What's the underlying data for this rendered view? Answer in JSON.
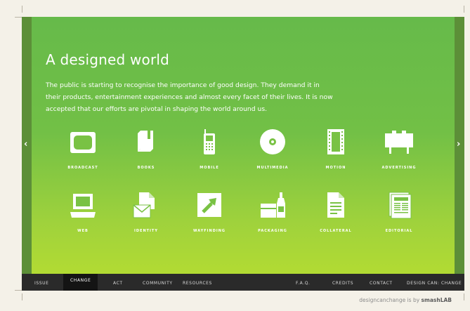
{
  "hero": {
    "title": "A designed world",
    "text": "The public is starting to recognise the importance of good design. They demand it in their products, entertainment experiences and almost every facet of their lives. It is now accepted that our efforts are pivotal in shaping the world around us."
  },
  "categories": [
    {
      "label": "BROADCAST",
      "icon": "tv-icon"
    },
    {
      "label": "BOOKS",
      "icon": "book-icon"
    },
    {
      "label": "MOBILE",
      "icon": "mobile-phone-icon"
    },
    {
      "label": "MULTIMEDIA",
      "icon": "disc-icon"
    },
    {
      "label": "MOTION",
      "icon": "film-strip-icon"
    },
    {
      "label": "ADVERTISING",
      "icon": "billboard-icon"
    },
    {
      "label": "WEB",
      "icon": "laptop-icon"
    },
    {
      "label": "IDENTITY",
      "icon": "stationery-icon"
    },
    {
      "label": "WAYFINDING",
      "icon": "arrow-sign-icon"
    },
    {
      "label": "PACKAGING",
      "icon": "package-bottle-icon"
    },
    {
      "label": "COLLATERAL",
      "icon": "document-icon"
    },
    {
      "label": "EDITORIAL",
      "icon": "magazine-icon"
    }
  ],
  "nav": {
    "issue": "ISSUE",
    "change": "CHANGE",
    "act": "ACT",
    "community": "COMMUNITY",
    "resources": "RESOURCES",
    "faq": "F.A.Q.",
    "credits": "CREDITS",
    "contact": "CONTACT",
    "design_can": "DESIGN CAN: CHANGE"
  },
  "footer": {
    "prefix": "designcanchange is by",
    "brand": "smashLAB"
  },
  "colors": {
    "hero_top": "#66ba4a",
    "hero_bottom": "#b2db33",
    "nav_bg": "#2a2a2a",
    "page_bg": "#f4f1e8"
  }
}
